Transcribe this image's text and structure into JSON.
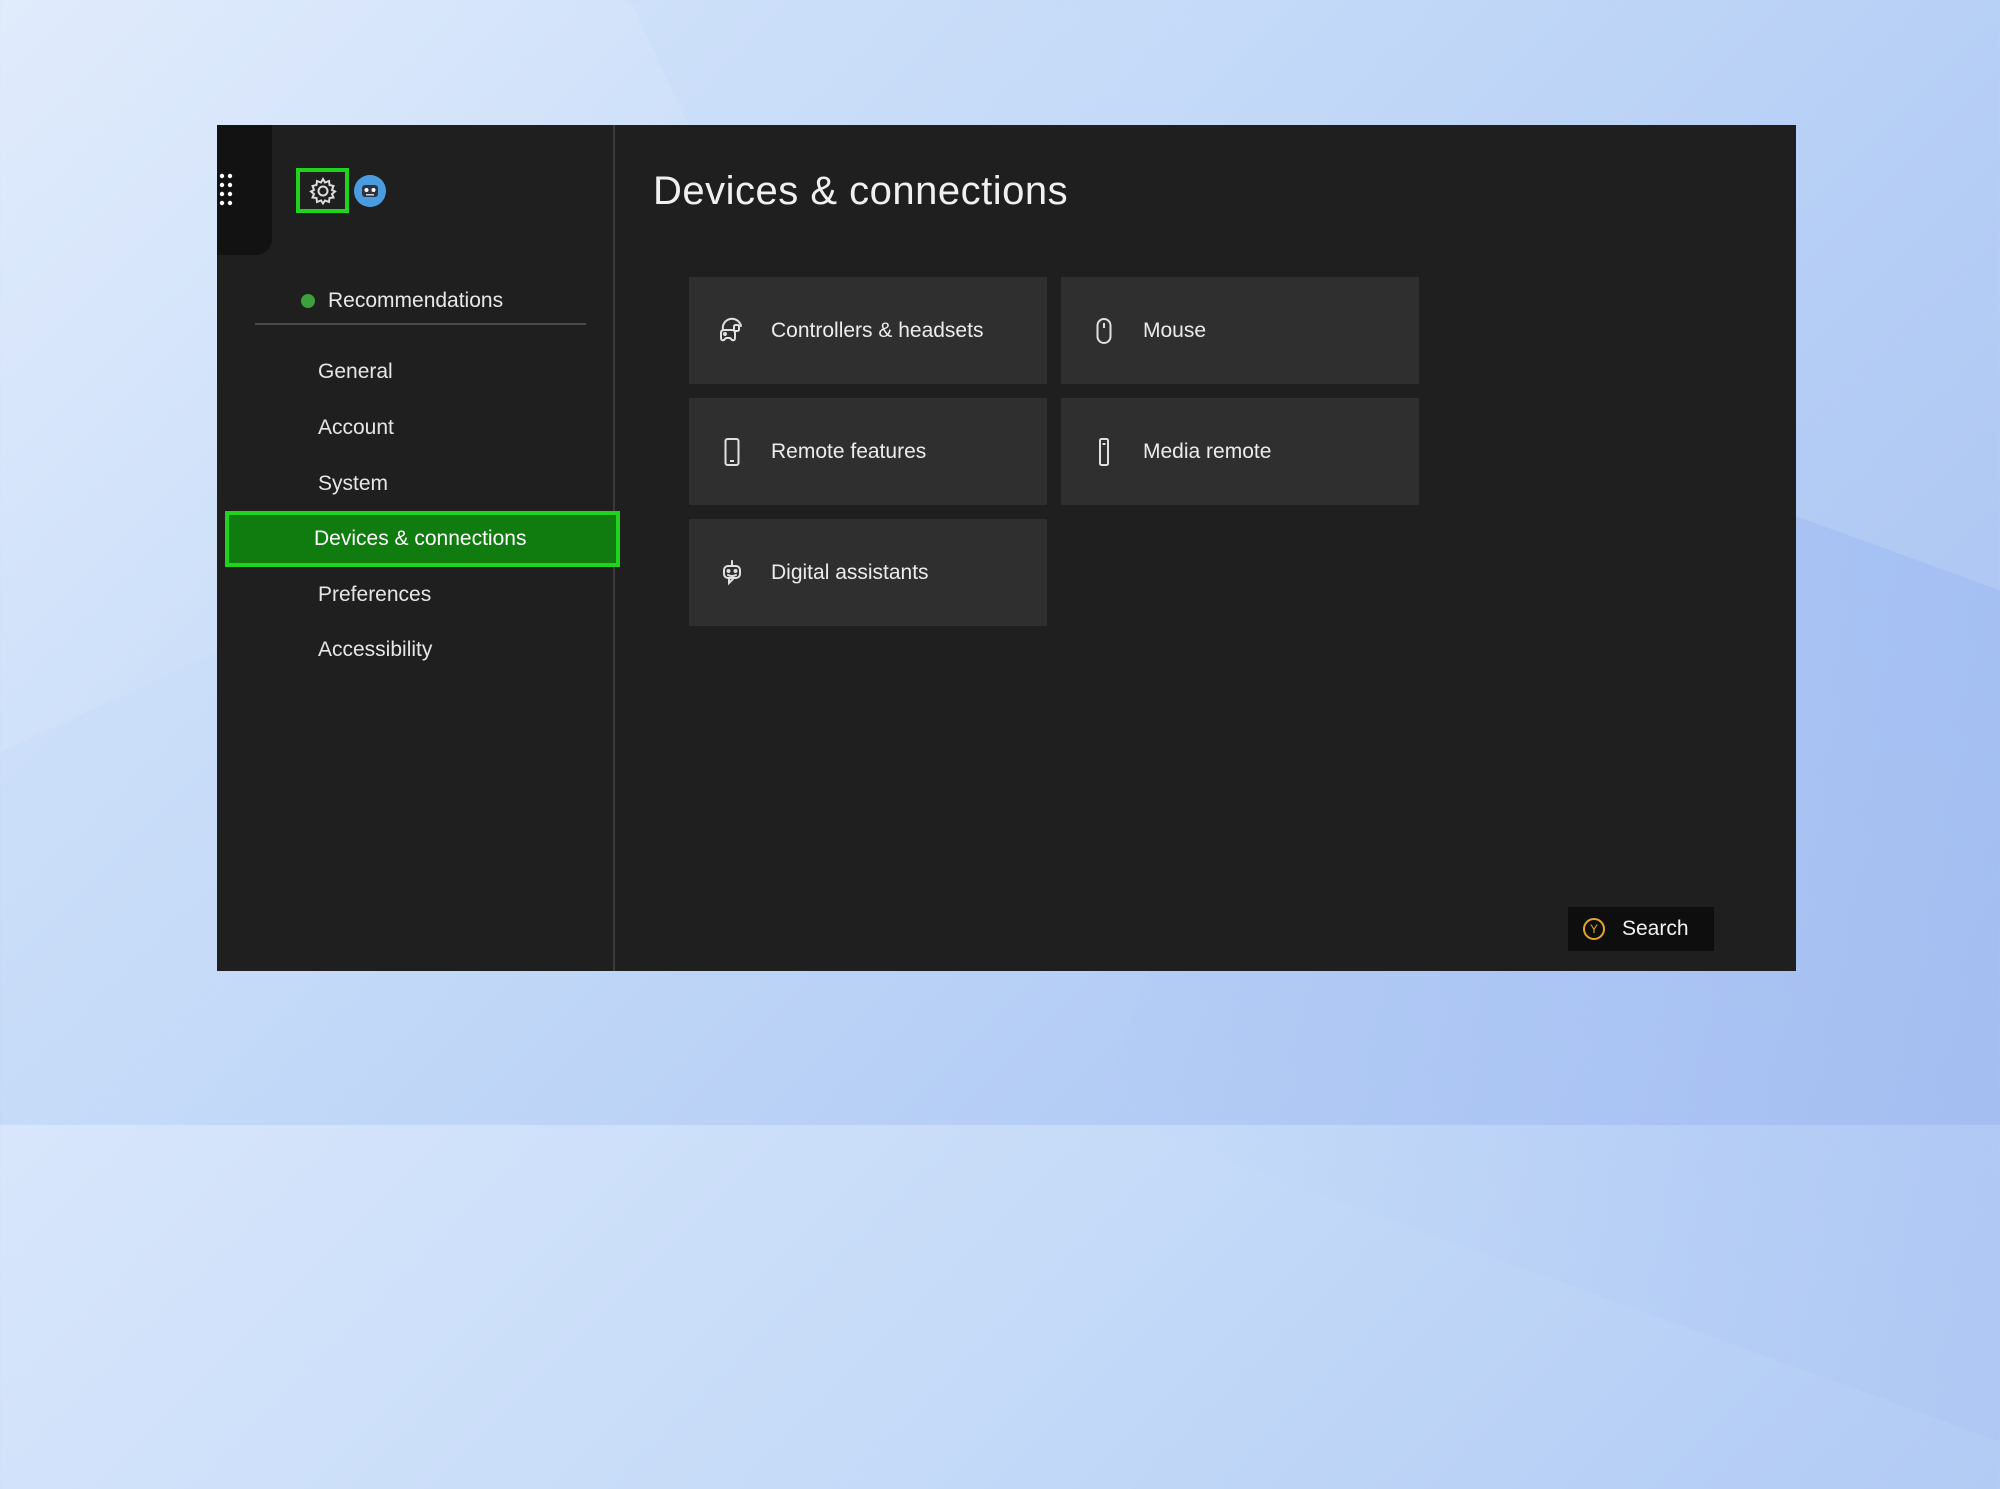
{
  "sidebar": {
    "recommendations": "Recommendations",
    "items": [
      {
        "label": "General"
      },
      {
        "label": "Account"
      },
      {
        "label": "System"
      },
      {
        "label": "Devices & connections",
        "active": true
      },
      {
        "label": "Preferences"
      },
      {
        "label": "Accessibility"
      }
    ]
  },
  "main": {
    "title": "Devices & connections",
    "tiles": [
      {
        "label": "Controllers & headsets",
        "icon": "controller-headset-icon"
      },
      {
        "label": "Mouse",
        "icon": "mouse-icon"
      },
      {
        "label": "Remote features",
        "icon": "phone-icon"
      },
      {
        "label": "Media remote",
        "icon": "media-remote-icon"
      },
      {
        "label": "Digital assistants",
        "icon": "digital-assistant-icon"
      }
    ]
  },
  "search": {
    "button_glyph": "Y",
    "label": "Search"
  },
  "colors": {
    "accent_green": "#107c10",
    "highlight_green": "#1fd31f",
    "panel_bg": "#1f1f1f",
    "tile_bg": "#2f2f2f"
  }
}
